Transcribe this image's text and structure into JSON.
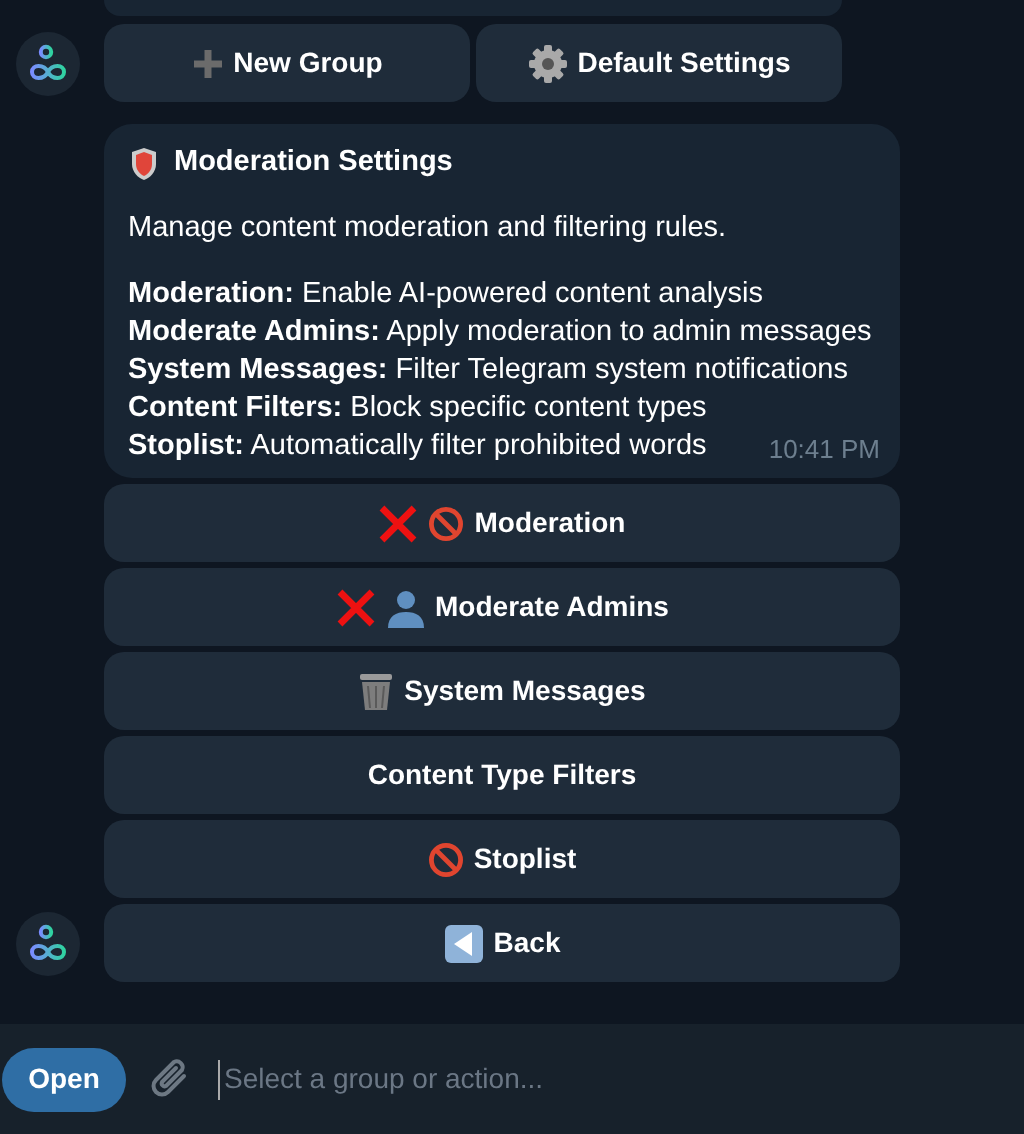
{
  "top_buttons": [
    {
      "label": "New Group",
      "kind": "plus"
    },
    {
      "label": "Default Settings",
      "kind": "gear"
    }
  ],
  "message": {
    "title": "Moderation Settings",
    "intro": "Manage content moderation and filtering rules.",
    "lines": [
      "**Moderation:** Enable AI-powered content analysis",
      "**Moderate Admins:** Apply moderation to admin messages",
      "**System Messages:** Filter Telegram system notifications",
      "**Content Filters:** Block specific content types",
      "**Stoplist:** Automatically filter prohibited words"
    ],
    "time": "10:41 PM"
  },
  "buttons": [
    {
      "label": "Moderation",
      "enabled": false,
      "kind": "block"
    },
    {
      "label": "Moderate Admins",
      "enabled": false,
      "kind": "user"
    },
    {
      "label": "System Messages",
      "kind": "trash"
    },
    {
      "label": "Content Type Filters",
      "kind": "plain"
    },
    {
      "label": "Stoplist",
      "kind": "block"
    },
    {
      "label": "Back",
      "kind": "back"
    }
  ],
  "composer": {
    "button": "Open",
    "placeholder": "Select a group or action..."
  }
}
